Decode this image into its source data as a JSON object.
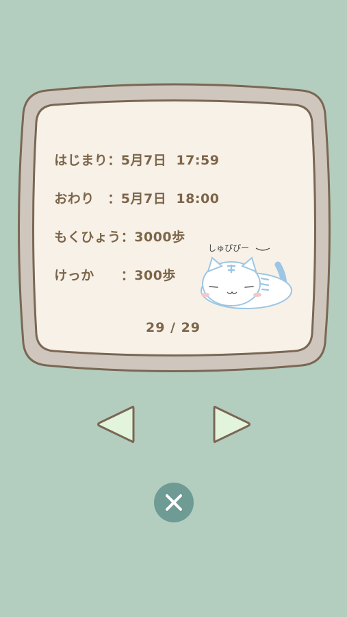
{
  "record": {
    "start": {
      "label": "はじまり",
      "value": "5月7日  17:59"
    },
    "end": {
      "label": "おわり　",
      "value": "5月7日  18:00"
    },
    "goal": {
      "label": "もくひょう",
      "value": "3000歩"
    },
    "result": {
      "label": "けっか　　",
      "value": "300歩"
    }
  },
  "separator": "：",
  "pagination": {
    "text": "29 / 29",
    "current": 29,
    "total": 29
  },
  "cat": {
    "caption": "しゅぴぴー",
    "icon": "sleeping-white-tiger-cat"
  },
  "nav": {
    "prev_icon": "triangle-left-icon",
    "next_icon": "triangle-right-icon"
  },
  "close": {
    "icon": "close-x-icon"
  },
  "colors": {
    "background": "#b3cdbf",
    "frame_outer": "#cfc6bd",
    "frame_border": "#7a6753",
    "panel": "#f7f1e8",
    "text": "#7c6548",
    "nav_fill": "#e2f5dc",
    "close_bg": "#6e9b94"
  }
}
